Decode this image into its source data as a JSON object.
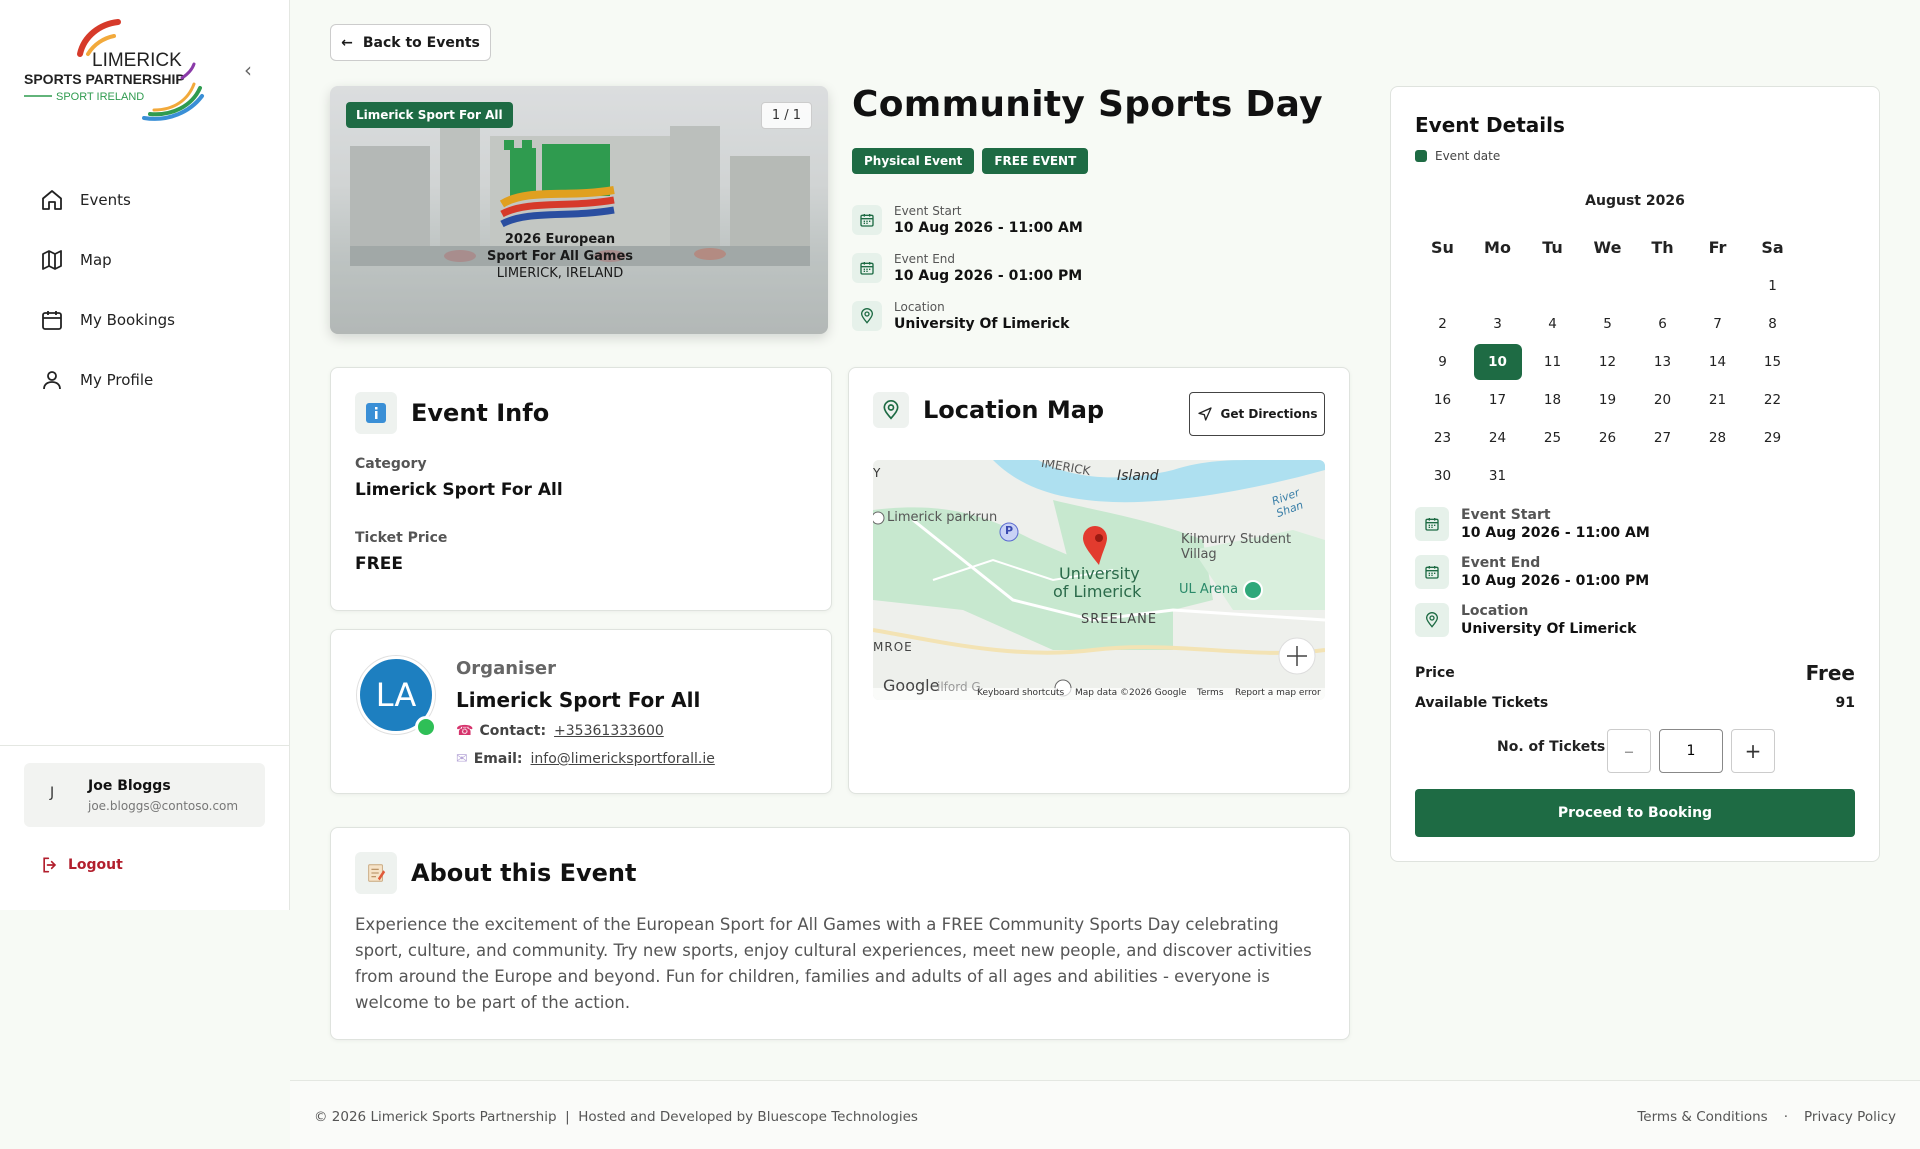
{
  "brand": {
    "line1": "LIMERICK",
    "line2": "SPORTS PARTNERSHIP",
    "line3": "SPORT IRELAND",
    "accent": "#1e6b44"
  },
  "sidebar": {
    "items": [
      {
        "label": "Events",
        "icon": "home-icon"
      },
      {
        "label": "Map",
        "icon": "map-icon"
      },
      {
        "label": "My Bookings",
        "icon": "calendar-icon"
      },
      {
        "label": "My Profile",
        "icon": "user-icon"
      }
    ],
    "user": {
      "initial": "J",
      "name": "Joe Bloggs",
      "email": "joe.bloggs@contoso.com"
    },
    "logout": "Logout"
  },
  "back_label": "Back to Events",
  "hero": {
    "badge": "Limerick Sport For All",
    "count": "1 / 1",
    "title1": "2026 European",
    "title2": "Sport For All Games",
    "title3": "LIMERICK, IRELAND"
  },
  "event": {
    "title": "Community Sports Day",
    "tags": [
      "Physical Event",
      "FREE EVENT"
    ],
    "start_label": "Event Start",
    "start_value": "10 Aug 2026 - 11:00 AM",
    "end_label": "Event End",
    "end_value": "10 Aug 2026 - 01:00 PM",
    "location_label": "Location",
    "location_value": "University Of Limerick"
  },
  "info": {
    "title": "Event Info",
    "category_label": "Category",
    "category_value": "Limerick Sport For All",
    "price_label": "Ticket Price",
    "price_value": "FREE"
  },
  "organiser": {
    "initials": "LA",
    "label": "Organiser",
    "name": "Limerick Sport For All",
    "contact_label": "Contact:",
    "contact_value": "+35361333600",
    "email_label": "Email:",
    "email_value": "info@limericksportforall.ie"
  },
  "map": {
    "title": "Location Map",
    "directions": "Get Directions",
    "labels": {
      "top": "IMERICK",
      "island": "Island",
      "river": "River Shan",
      "parkrun": "Limerick parkrun",
      "kilmurry": "Kilmurry Student Villag",
      "univ1": "University",
      "univ2": "of Limerick",
      "arena": "UL Arena",
      "sreelane": "SREELANE",
      "mroe": "MROE",
      "google": "Google",
      "milford": "ilford G",
      "p": "P",
      "y": "Y",
      "shortcuts": "Keyboard shortcuts",
      "mapdata": "Map data ©2026 Google",
      "terms": "Terms",
      "report": "Report a map error"
    }
  },
  "about": {
    "title": "About this Event",
    "text": "Experience the excitement of the European Sport for All Games with a FREE Community Sports Day celebrating sport, culture, and community. Try new sports, enjoy cultural experiences, meet new people, and discover activities from around the Europe and beyond. Fun for children, families and adults of all ages and abilities - everyone is welcome to be part of the action."
  },
  "details": {
    "title": "Event Details",
    "legend": "Event date",
    "month": "August 2026",
    "weekdays": [
      "Su",
      "Mo",
      "Tu",
      "We",
      "Th",
      "Fr",
      "Sa"
    ],
    "weeks": [
      [
        "",
        "",
        "",
        "",
        "",
        "",
        "1"
      ],
      [
        "2",
        "3",
        "4",
        "5",
        "6",
        "7",
        "8"
      ],
      [
        "9",
        "10",
        "11",
        "12",
        "13",
        "14",
        "15"
      ],
      [
        "16",
        "17",
        "18",
        "19",
        "20",
        "21",
        "22"
      ],
      [
        "23",
        "24",
        "25",
        "26",
        "27",
        "28",
        "29"
      ],
      [
        "30",
        "31",
        "",
        "",
        "",
        "",
        ""
      ]
    ],
    "selected_day": "10",
    "start_label": "Event Start",
    "start_value": "10 Aug 2026 - 11:00 AM",
    "end_label": "Event End",
    "end_value": "10 Aug 2026 - 01:00 PM",
    "location_label": "Location",
    "location_value": "University Of Limerick",
    "price_label": "Price",
    "price_value": "Free",
    "tickets_label": "Available Tickets",
    "tickets_value": "91",
    "qty_label": "No. of Tickets",
    "qty_value": "1",
    "minus": "–",
    "plus": "+",
    "book": "Proceed to Booking"
  },
  "footer": {
    "left": "© 2026 Limerick Sports Partnership  |  Hosted and Developed by Bluescope Technologies",
    "terms": "Terms & Conditions",
    "dot": "·",
    "privacy": "Privacy Policy"
  }
}
